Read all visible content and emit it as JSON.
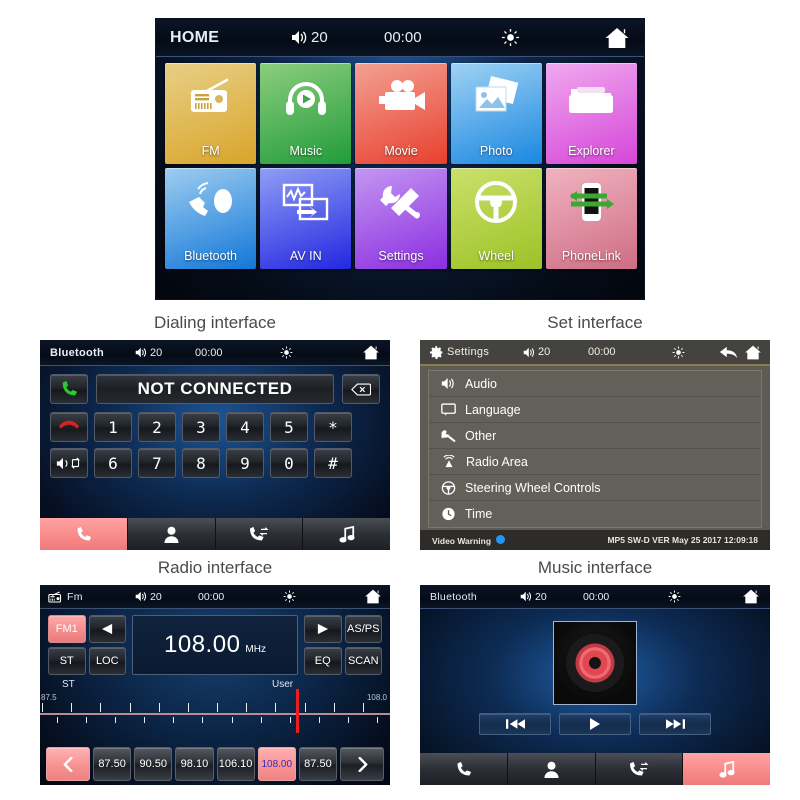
{
  "captions": {
    "dialing": "Dialing interface",
    "set": "Set interface",
    "radio": "Radio interface",
    "music": "Music interface"
  },
  "colors": {
    "accent_red": "#f58d8d",
    "needle_red": "#ee1c1c",
    "status_blue": "#2196f3",
    "settings_bg": "#5e5b55"
  },
  "home": {
    "status": {
      "title": "HOME",
      "volume": "20",
      "clock": "00:00",
      "speaker_icon": "speaker-icon",
      "brightness_icon": "sun-icon",
      "home_icon": "home-icon"
    },
    "tiles": [
      {
        "label": "FM",
        "icon": "radio-icon",
        "c1": "#e8cf86",
        "c2": "#d9a52a"
      },
      {
        "label": "Music",
        "icon": "headphones-icon",
        "c1": "#8ccd7e",
        "c2": "#219c3b"
      },
      {
        "label": "Movie",
        "icon": "camcorder-icon",
        "c1": "#f3a193",
        "c2": "#e8402e"
      },
      {
        "label": "Photo",
        "icon": "photos-icon",
        "c1": "#9fd2f4",
        "c2": "#1a87e0"
      },
      {
        "label": "Explorer",
        "icon": "folder-icon",
        "c1": "#f0a9ef",
        "c2": "#d646d9"
      },
      {
        "label": "Bluetooth",
        "icon": "bluetooth-phone-icon",
        "c1": "#9ecdf0",
        "c2": "#1277d8"
      },
      {
        "label": "AV IN",
        "icon": "av-in-icon",
        "c1": "#8f9ef5",
        "c2": "#2327e0"
      },
      {
        "label": "Settings",
        "icon": "tools-icon",
        "c1": "#c496f2",
        "c2": "#8b2ee0"
      },
      {
        "label": "Wheel",
        "icon": "steering-icon",
        "c1": "#cbe06b",
        "c2": "#9cc226"
      },
      {
        "label": "PhoneLink",
        "icon": "phonelink-icon",
        "c1": "#f0b3c0",
        "c2": "#cf6d85"
      }
    ]
  },
  "dial": {
    "status": {
      "title": "Bluetooth",
      "volume": "20",
      "clock": "00:00"
    },
    "number_display": "NOT CONNECTED",
    "call_button_icon": "green-handset-icon",
    "delete_button_icon": "backspace-icon",
    "hangup_button_icon": "red-handset-icon",
    "audio_switch_icon": "audio-transfer-icon",
    "keys_row1": [
      "1",
      "2",
      "3",
      "4",
      "5",
      "*"
    ],
    "keys_row2": [
      "6",
      "7",
      "8",
      "9",
      "0",
      "#"
    ],
    "tabs": [
      {
        "icon": "handset-icon",
        "name": "dial-tab",
        "active": true
      },
      {
        "icon": "contact-icon",
        "name": "contacts-tab",
        "active": false
      },
      {
        "icon": "call-history-icon",
        "name": "history-tab",
        "active": false
      },
      {
        "icon": "music-note-icon",
        "name": "bt-music-tab",
        "active": false
      }
    ]
  },
  "settings": {
    "status": {
      "title": "Settings",
      "volume": "20",
      "clock": "00:00",
      "gear_icon": "gear-icon",
      "back_icon": "back-arrow-icon",
      "home_icon": "home-icon"
    },
    "items": [
      {
        "label": "Audio",
        "icon": "speaker-icon"
      },
      {
        "label": "Language",
        "icon": "chat-bubble-icon"
      },
      {
        "label": "Other",
        "icon": "wrench-icon"
      },
      {
        "label": "Radio Area",
        "icon": "antenna-icon"
      },
      {
        "label": "Steering Wheel Controls",
        "icon": "steering-icon"
      },
      {
        "label": "Time",
        "icon": "clock-icon"
      }
    ],
    "footer_left": "Video Warning",
    "footer_right": "MP5 SW-D VER May 25 2017 12:09:18"
  },
  "radio": {
    "status": {
      "title": "Fm",
      "volume": "20",
      "clock": "00:00",
      "radio_icon": "radio-icon"
    },
    "band_button": "FM1",
    "prev_icon": "left-triangle-icon",
    "next_icon": "right-triangle-icon",
    "st_button": "ST",
    "loc_button": "LOC",
    "asps_button": "AS/PS",
    "eq_button": "EQ",
    "scan_button": "SCAN",
    "frequency": "108.00",
    "unit": "MHz",
    "scale": {
      "left_label": "87.5",
      "right_label": "108.0",
      "st_label": "ST",
      "user_label": "User",
      "needle_percent": 73
    },
    "presets": [
      "87.50",
      "90.50",
      "98.10",
      "106.10",
      "108.00",
      "87.50"
    ],
    "current_preset_index": 4,
    "nav_prev_icon": "chevron-left-icon",
    "nav_next_icon": "chevron-right-icon"
  },
  "music": {
    "status": {
      "title": "Bluetooth",
      "volume": "20",
      "clock": "00:00"
    },
    "album_art": "vinyl-disc-icon",
    "controls": [
      {
        "icon": "previous-track-icon",
        "name": "prev-track-button"
      },
      {
        "icon": "play-icon",
        "name": "play-button"
      },
      {
        "icon": "next-track-icon",
        "name": "next-track-button"
      }
    ],
    "tabs": [
      {
        "icon": "handset-icon",
        "name": "dial-tab",
        "active": false
      },
      {
        "icon": "contact-icon",
        "name": "contacts-tab",
        "active": false
      },
      {
        "icon": "call-history-icon",
        "name": "history-tab",
        "active": false
      },
      {
        "icon": "music-note-icon",
        "name": "bt-music-tab",
        "active": true
      }
    ]
  }
}
